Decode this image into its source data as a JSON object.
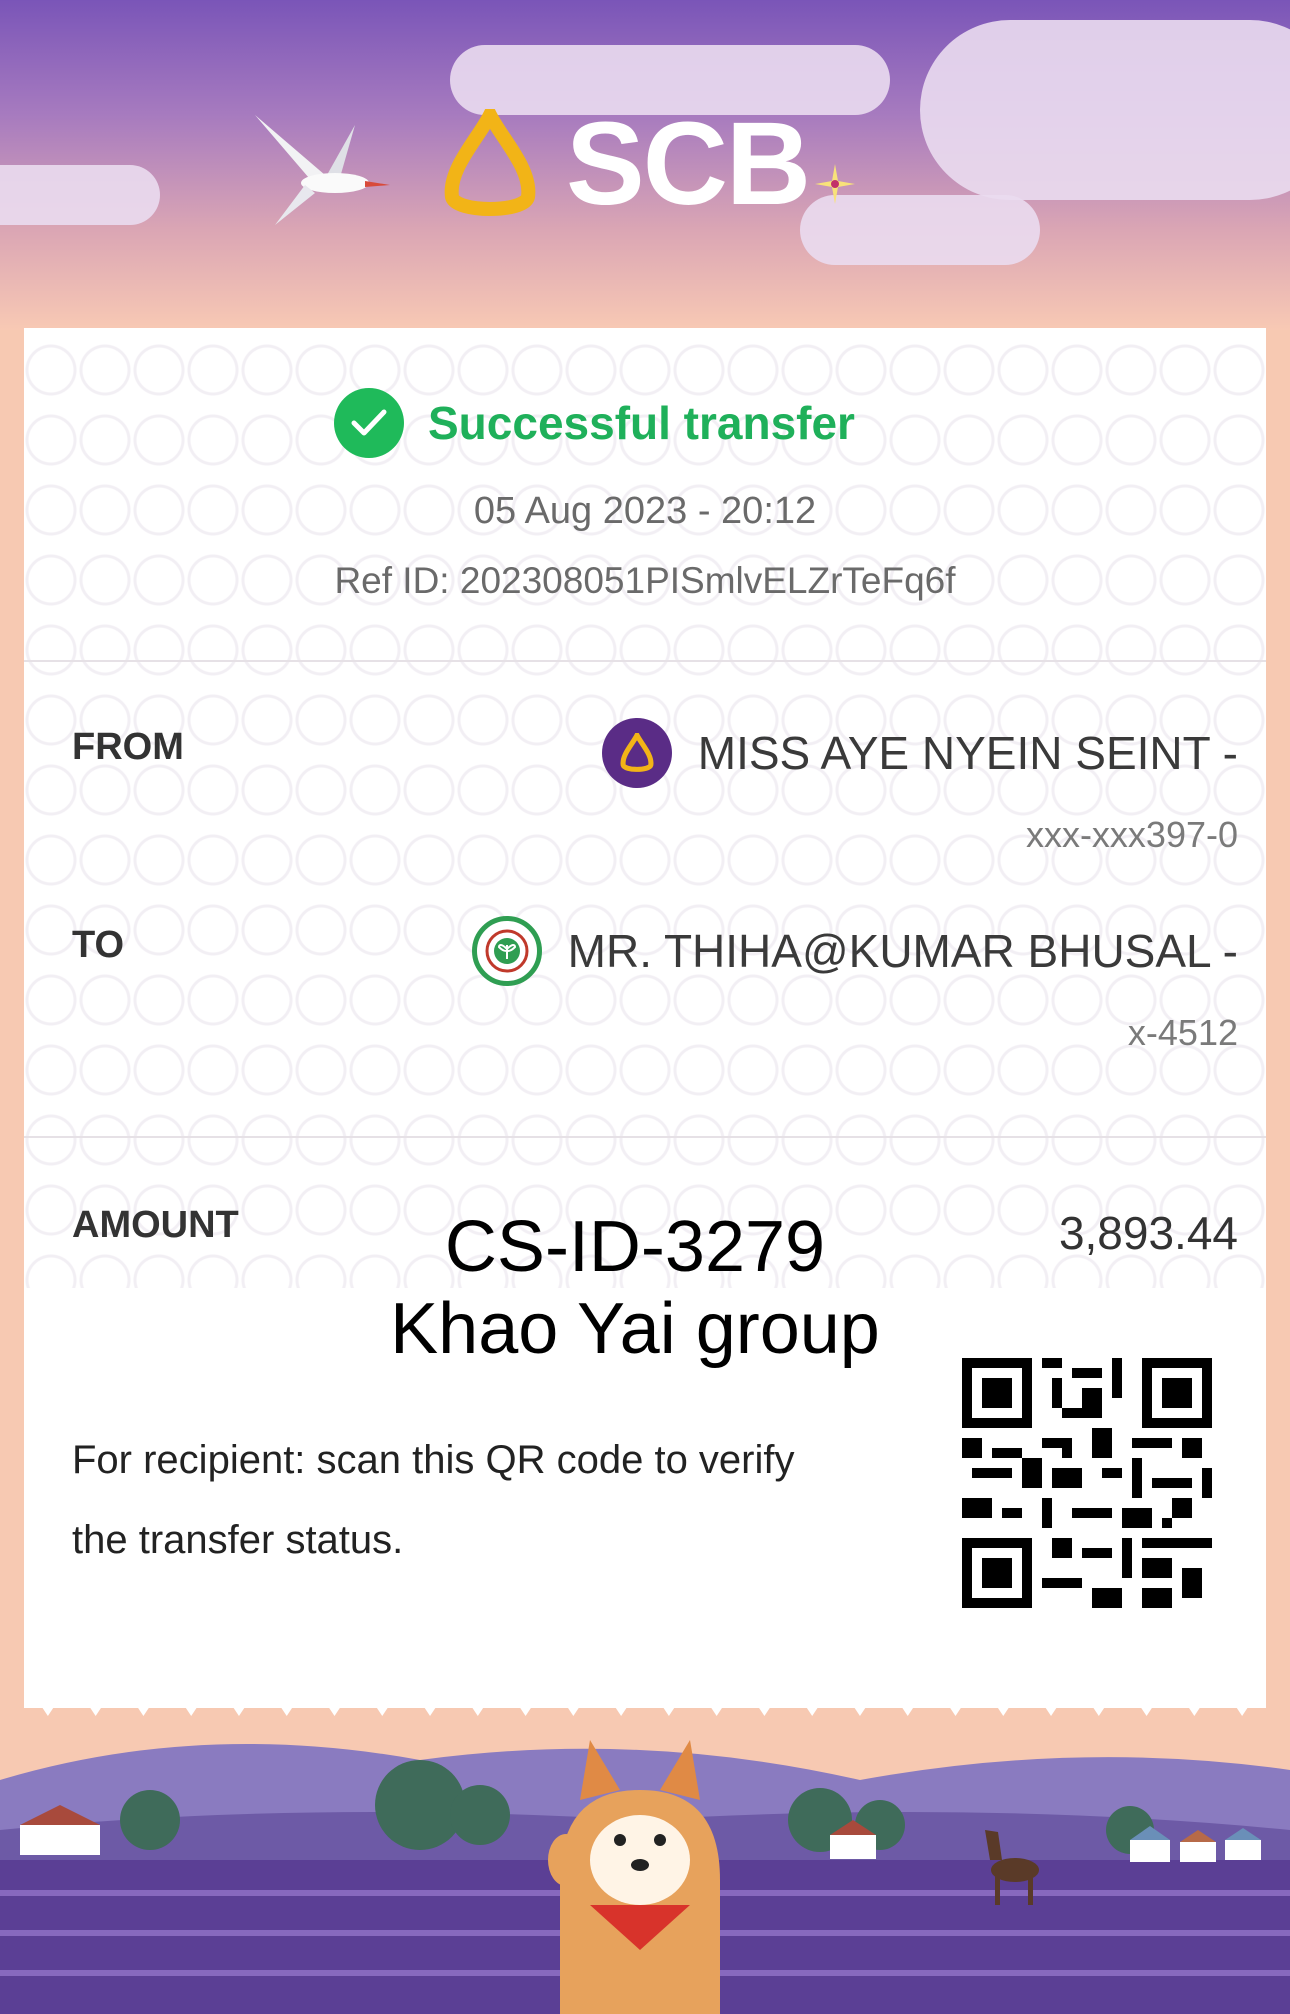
{
  "header": {
    "brand": "SCB"
  },
  "status": {
    "title": "Successful transfer",
    "datetime": "05 Aug 2023 - 20:12",
    "ref": "Ref ID: 202308051PISmlvELZrTeFq6f"
  },
  "from": {
    "label": "FROM",
    "name": "MISS AYE NYEIN SEINT -",
    "account": "xxx-xxx397-0",
    "bank_icon": "scb-bank-icon"
  },
  "to": {
    "label": "TO",
    "name": "MR. THIHA@KUMAR BHUSAL -",
    "account": "x-4512",
    "bank_icon": "kbank-icon"
  },
  "amount": {
    "label": "AMOUNT",
    "value": "3,893.44"
  },
  "overlay": {
    "line1": "CS-ID-3279",
    "line2": "Khao Yai group"
  },
  "note": {
    "text": "For recipient: scan this QR code to verify the transfer status."
  },
  "colors": {
    "brand_purple": "#5a2c86",
    "success_green": "#1fb05a",
    "background_peach": "#f7c9b2"
  }
}
